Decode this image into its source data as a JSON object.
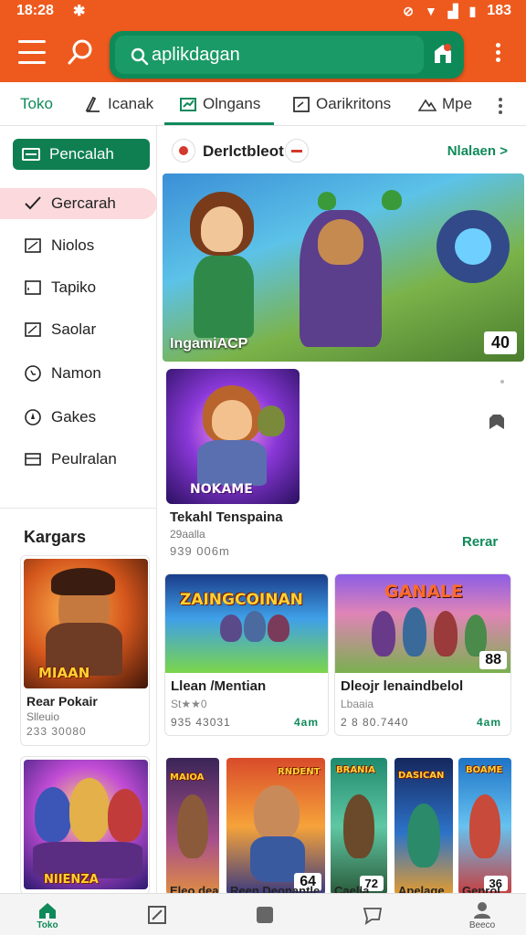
{
  "status_bar": {
    "time": "18:28",
    "battery": "183"
  },
  "search": {
    "placeholder": "aplikdagan"
  },
  "tabs": [
    {
      "label": "Toko",
      "icon": "none"
    },
    {
      "label": "Icanak",
      "icon": "pen-icon"
    },
    {
      "label": "Olngans",
      "icon": "chart-icon"
    },
    {
      "label": "Oarikritons",
      "icon": "box-icon"
    },
    {
      "label": "Mpe",
      "icon": "mountain-icon"
    }
  ],
  "sidebar": {
    "primary_button": "Pencalah",
    "items": [
      {
        "label": "Gercarah",
        "active": true
      },
      {
        "label": "Niolos"
      },
      {
        "label": "Tapiko"
      },
      {
        "label": "Saolar"
      },
      {
        "label": "Namon"
      },
      {
        "label": "Gakes"
      },
      {
        "label": "Peulralan"
      }
    ],
    "section_title": "Kargars",
    "cards": [
      {
        "title": "Rear Pokair",
        "sub": "Slleuio",
        "meta": "233 30080",
        "banner": "MIAAN"
      },
      {
        "title": "",
        "sub": "",
        "meta": "",
        "banner": "NIIENZA"
      }
    ]
  },
  "main": {
    "developer_name": "Derlctbleot",
    "see_more": "Nlalaen >",
    "hero": {
      "label": "IngamiACP",
      "count": "40"
    },
    "featured": {
      "title": "Tekahl Tenspaina",
      "sub": "29aalla",
      "meta": "939 006m",
      "action": "Rerar",
      "banner": "NOKAME"
    },
    "mid_cards": [
      {
        "banner": "ZAINGCOINAN",
        "title": "Llean /Mentian",
        "sub": "St★★0",
        "meta": "935 43031",
        "size": "4am"
      },
      {
        "banner": "GANALE",
        "title": "Dleojr lenaindbelol",
        "sub": "Lbaaia",
        "meta": "2 8 80.7440",
        "size": "4am",
        "count": "88"
      }
    ],
    "row_cards": [
      {
        "title": "Eleo deal",
        "banner": "MAIOA"
      },
      {
        "title": "Reen Deonantle",
        "banner": "RNDENT",
        "count": "64"
      },
      {
        "title": "Caella",
        "banner": "BRANIA",
        "count": "72"
      },
      {
        "title": "Apelage",
        "banner": "DASICAN"
      },
      {
        "title": "Genrol",
        "banner": "BOAME",
        "count": "36"
      }
    ]
  },
  "bottom_nav": [
    {
      "label": "Toko",
      "icon": "home-icon",
      "active": true
    },
    {
      "label": "",
      "icon": "edit-icon"
    },
    {
      "label": "",
      "icon": "square-icon"
    },
    {
      "label": "",
      "icon": "chat-icon"
    },
    {
      "label": "Beeco",
      "icon": "person-icon"
    }
  ]
}
